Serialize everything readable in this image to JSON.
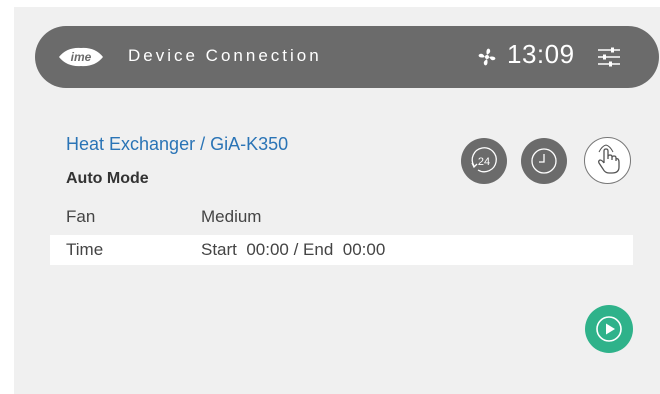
{
  "header": {
    "logo_text": "ime",
    "title": "Device Connection",
    "time": "13:09",
    "icons": [
      "logo-icon",
      "fan-icon",
      "settings-sliders-icon"
    ]
  },
  "device": {
    "name": "Heat Exchanger / GiA-K350",
    "mode": "Auto Mode"
  },
  "details": [
    {
      "label": "Fan",
      "value": "Medium"
    },
    {
      "label": "Time",
      "value": "Start  00:00 / End  00:00"
    }
  ],
  "controls": {
    "timer24_label": "24",
    "icons": [
      "timer-24h-icon",
      "schedule-clock-icon",
      "manual-hand-icon",
      "play-icon"
    ]
  },
  "colors": {
    "header_bg": "#6b6b6b",
    "device_name": "#2a74b6",
    "play_button": "#2fb28a"
  }
}
